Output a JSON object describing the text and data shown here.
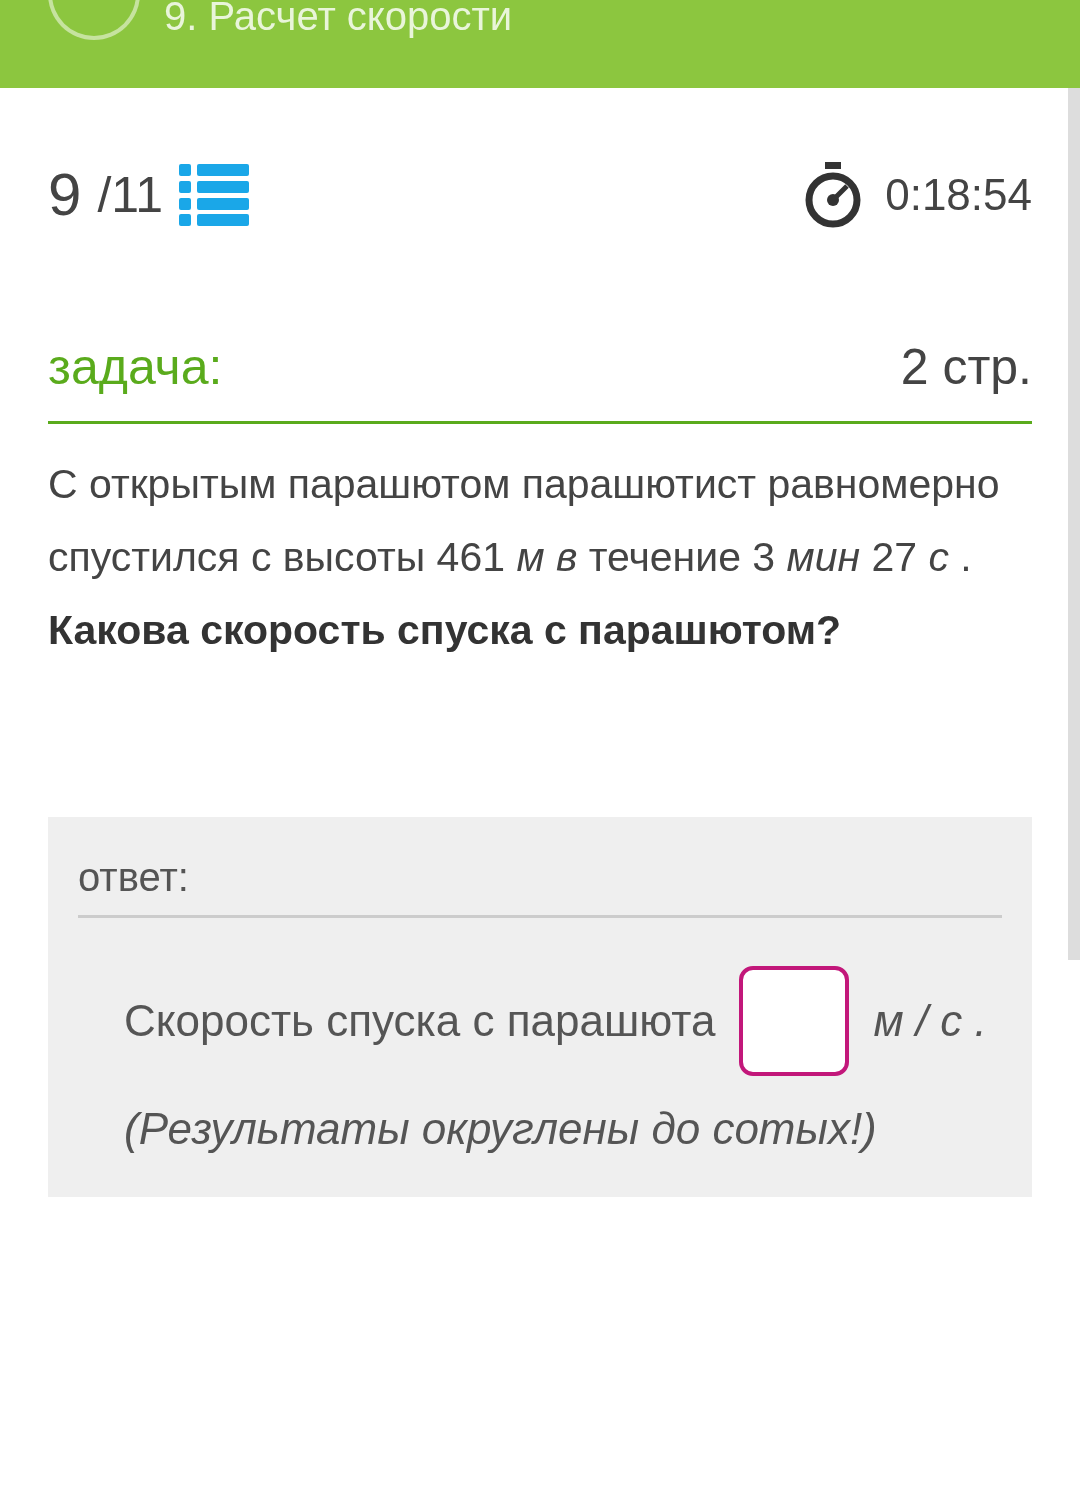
{
  "header": {
    "title": "9. Расчет скорости"
  },
  "progress": {
    "current": "9",
    "total": "/11"
  },
  "timer": "0:18:54",
  "task": {
    "label": "задача:",
    "points": "2 стр.",
    "text": "С открытым парашютом парашютист равномерно спустился с высоты 461  *м в* течение 3  *мин* 27  *с* . **Какова скорость спуска с парашютом?**"
  },
  "answer": {
    "label": "ответ:",
    "prompt": "Скорость спуска с парашюта",
    "unit": "м / с .",
    "note": "(Результаты округлены до сотых!)"
  }
}
